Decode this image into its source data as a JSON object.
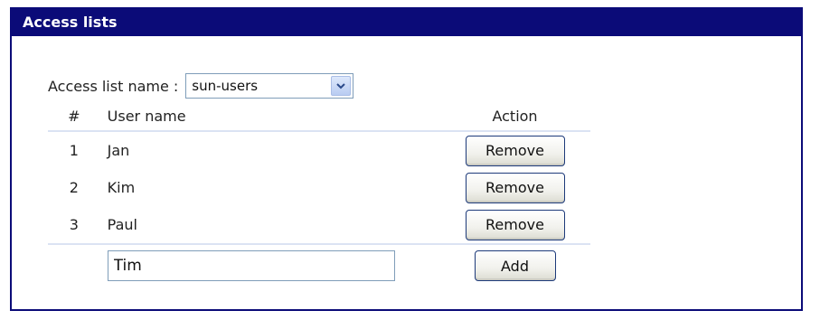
{
  "panel": {
    "title": "Access lists"
  },
  "access_list": {
    "label": "Access list name :",
    "selected": "sun-users"
  },
  "table": {
    "headers": {
      "num": "#",
      "user": "User name",
      "action": "Action"
    },
    "rows": [
      {
        "num": "1",
        "user": "Jan",
        "action": "Remove"
      },
      {
        "num": "2",
        "user": "Kim",
        "action": "Remove"
      },
      {
        "num": "3",
        "user": "Paul",
        "action": "Remove"
      }
    ],
    "new_user_value": "Tim",
    "add_label": "Add"
  },
  "icons": {
    "dropdown": "chevron-down-icon"
  },
  "colors": {
    "header_bg": "#0b0b78",
    "header_text": "#ffffff",
    "divider": "#dbe3f3",
    "button_border": "#1d3a7a"
  }
}
